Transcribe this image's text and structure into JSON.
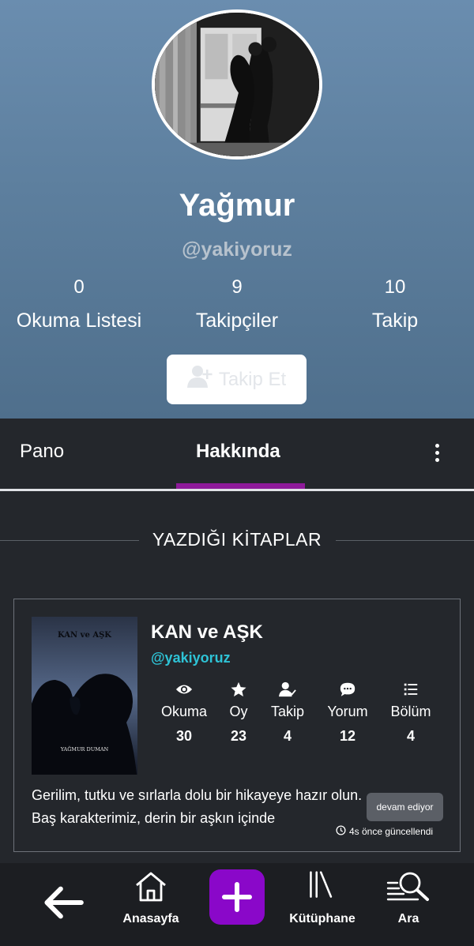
{
  "profile": {
    "name": "Yağmur",
    "handle": "@yakiyoruz",
    "follow_button": "Takip Et"
  },
  "stats": [
    {
      "value": "0",
      "label": "Okuma Listesi"
    },
    {
      "value": "9",
      "label": "Takipçiler"
    },
    {
      "value": "10",
      "label": "Takip"
    }
  ],
  "tabs": {
    "pano": "Pano",
    "about": "Hakkında",
    "active": "Hakkında"
  },
  "section": {
    "title": "YAZDIĞI KİTAPLAR"
  },
  "book": {
    "title": "KAN ve AŞK",
    "author": "@yakiyoruz",
    "cover_title": "KAN ve AŞK",
    "cover_author": "YAĞMUR DUMAN",
    "stats": [
      {
        "icon": "eye-icon",
        "label": "Okuma",
        "value": "30"
      },
      {
        "icon": "star-icon",
        "label": "Oy",
        "value": "23"
      },
      {
        "icon": "user-check-icon",
        "label": "Takip",
        "value": "4"
      },
      {
        "icon": "comment-icon",
        "label": "Yorum",
        "value": "12"
      },
      {
        "icon": "list-icon",
        "label": "Bölüm",
        "value": "4"
      }
    ],
    "description": "Gerilim, tutku ve sırlarla dolu bir hikayeye hazır olun. Baş karakterimiz, derin bir aşkın içinde",
    "status": "devam ediyor",
    "updated": "4s önce güncellendi"
  },
  "nav": {
    "home": "Anasayfa",
    "library": "Kütüphane",
    "search": "Ara"
  },
  "colors": {
    "accent": "#8a08c9",
    "tab_indicator": "#8e1a9a",
    "author_link": "#2ec3d6",
    "background": "#24272c"
  }
}
